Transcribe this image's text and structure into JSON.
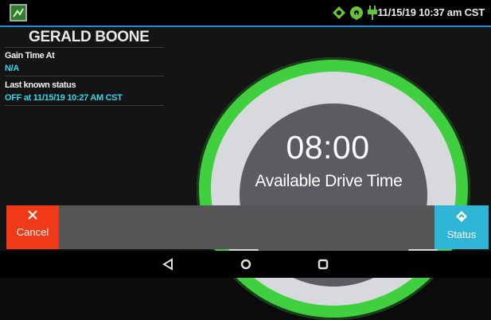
{
  "status_bar": {
    "datetime": "11/15/19 10:37 am CST",
    "icons": [
      "gps-icon",
      "signal-icon",
      "power-plug-icon"
    ]
  },
  "driver": {
    "name": "GERALD BOONE"
  },
  "fields": {
    "gain_time_label": "Gain Time At",
    "gain_time_value": "N/A",
    "last_status_label": "Last known status",
    "last_status_value": "OFF at 11/15/19 10:27 AM CST"
  },
  "gauge": {
    "time": "08:00",
    "label": "Available Drive Time",
    "ring_color": "#3fcf3f"
  },
  "actions": {
    "cancel_label": "Cancel",
    "status_label": "Status",
    "cancel_color": "#f03a17",
    "status_color": "#2fb6d6"
  },
  "nav": {
    "icons": [
      "back-icon",
      "home-icon",
      "recents-icon"
    ]
  }
}
